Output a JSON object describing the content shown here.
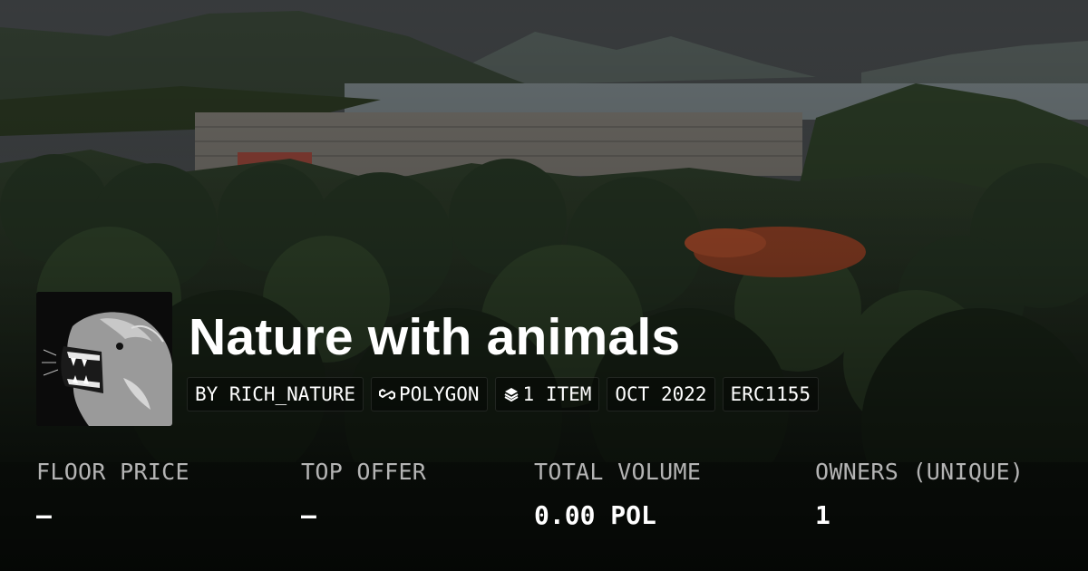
{
  "collection": {
    "title": "Nature with animals"
  },
  "meta": [
    {
      "icon": "",
      "label": "BY RICH_NATURE"
    },
    {
      "icon": "polygon-chain-icon",
      "label": "POLYGON"
    },
    {
      "icon": "layers-icon",
      "label": "1 ITEM"
    },
    {
      "icon": "",
      "label": "OCT 2022"
    },
    {
      "icon": "",
      "label": "ERC1155"
    }
  ],
  "stats": [
    {
      "label": "FLOOR PRICE",
      "value": "–"
    },
    {
      "label": "TOP OFFER",
      "value": "–"
    },
    {
      "label": "TOTAL VOLUME",
      "value": "0.00 POL"
    },
    {
      "label": "OWNERS (UNIQUE)",
      "value": "1"
    }
  ],
  "colors": {
    "text": "#ffffff",
    "label": "#b4b4b4",
    "pill_bg": "rgba(0,0,0,0.38)"
  }
}
